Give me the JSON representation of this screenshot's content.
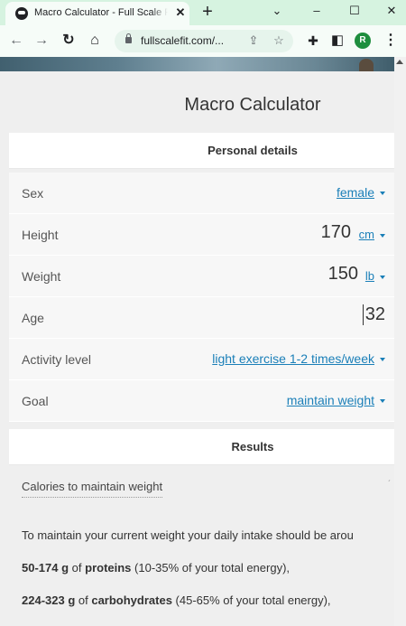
{
  "browser": {
    "tab_title": "Macro Calculator - Full Scale Fit",
    "tab_close": "✕",
    "new_tab": "+",
    "window_controls": [
      "⌄",
      "–",
      "☐",
      "✕"
    ],
    "url": "fullscalefit.com/...",
    "nav_icons": [
      "←",
      "→",
      "↻",
      "⌂"
    ],
    "toolbar_icons": [
      "share-icon",
      "star-icon",
      "extensions-icon",
      "sidepanel-icon"
    ],
    "profile_initial": "R",
    "menu_icon": "⋮"
  },
  "calculator": {
    "title": "Macro Calculator",
    "personal_section": "Personal details",
    "fields": {
      "sex": {
        "label": "Sex",
        "value": "female"
      },
      "height": {
        "label": "Height",
        "value": "170",
        "unit": "cm"
      },
      "weight": {
        "label": "Weight",
        "value": "150",
        "unit": "lb"
      },
      "age": {
        "label": "Age",
        "value": "32"
      },
      "activity": {
        "label": "Activity level",
        "value": "light exercise 1-2 times/week"
      },
      "goal": {
        "label": "Goal",
        "value": "maintain weight"
      }
    },
    "results_section": "Results",
    "results": {
      "subsection": "Calories to maintain weight",
      "intro": "To maintain your current weight your daily intake should be arou",
      "proteins_amount": "50-174 g",
      "proteins_of": " of ",
      "proteins_label": "proteins",
      "proteins_note": " (10-35% of your total energy),",
      "carbs_amount": "224-323 g",
      "carbs_of": " of ",
      "carbs_label": "carbohydrates",
      "carbs_note": " (45-65% of your total energy),"
    }
  }
}
